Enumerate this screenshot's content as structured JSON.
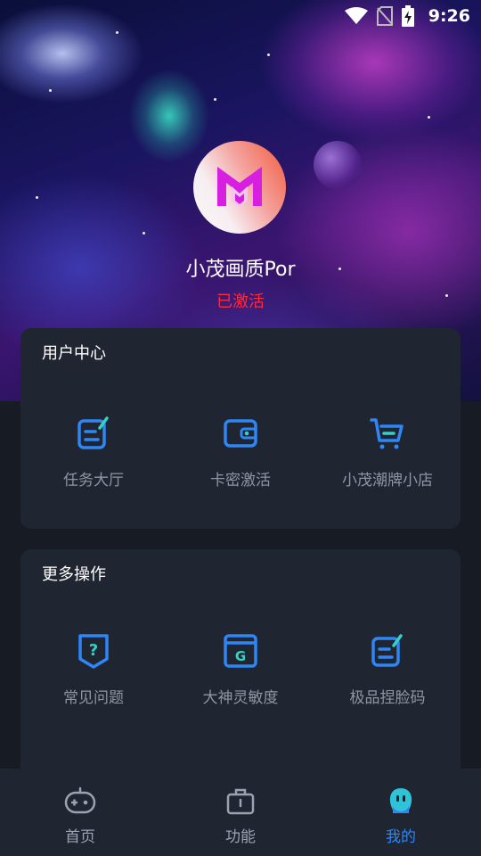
{
  "status_bar": {
    "time": "9:26"
  },
  "profile": {
    "username": "小茂画质Por",
    "status": "已激活",
    "avatar_letter": "M"
  },
  "user_center": {
    "title": "用户中心",
    "items": [
      {
        "label": "任务大厅",
        "icon": "task-icon"
      },
      {
        "label": "卡密激活",
        "icon": "wallet-icon"
      },
      {
        "label": "小茂潮牌小店",
        "icon": "cart-icon"
      }
    ]
  },
  "more_actions": {
    "title": "更多操作",
    "items": [
      {
        "label": "常见问题",
        "icon": "faq-icon",
        "glyph": "?"
      },
      {
        "label": "大神灵敏度",
        "icon": "sensitivity-icon",
        "glyph": "G"
      },
      {
        "label": "极品捏脸码",
        "icon": "face-code-icon"
      }
    ]
  },
  "tabbar": {
    "items": [
      {
        "label": "首页",
        "icon": "gamepad-icon"
      },
      {
        "label": "功能",
        "icon": "toolbox-icon"
      },
      {
        "label": "我的",
        "icon": "mascot-icon"
      }
    ],
    "active_index": 2
  },
  "colors": {
    "accent": "#2f86f6",
    "status_red": "#ff2a3a",
    "card_bg": "#1f2531",
    "page_bg": "#161b24"
  }
}
